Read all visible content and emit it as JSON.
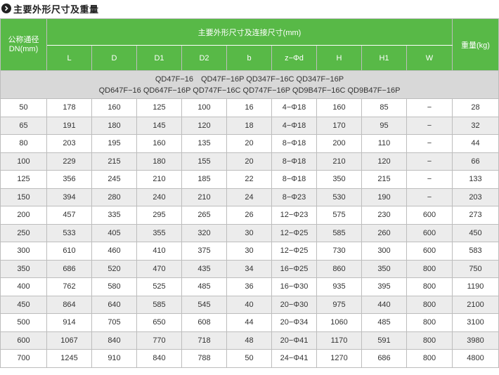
{
  "heading": {
    "title": "主要外形尺寸及重量",
    "icon": "chevron-right-icon"
  },
  "header": {
    "dn_label_line1": "公称通径",
    "dn_label_line2": "DN(mm)",
    "group_label": "主要外形尺寸及连接尺寸(mm)",
    "weight_label": "重量(kg)",
    "columns": [
      "L",
      "D",
      "D1",
      "D2",
      "b",
      "z−Φd",
      "H",
      "H1",
      "W"
    ]
  },
  "models": {
    "line1": "QD47F−16　QD47F−16P QD347F−16C QD347F−16P",
    "line2": "QD647F−16 QD647F−16P QD747F−16C QD747F−16P  QD9B47F−16C QD9B47F−16P"
  },
  "colors": {
    "header_bg": "#58b947",
    "models_bg": "#d8d8d8",
    "alt_row_bg": "#ececec"
  },
  "rows": [
    [
      "50",
      "178",
      "160",
      "125",
      "100",
      "16",
      "4−Φ18",
      "160",
      "85",
      "−",
      "28"
    ],
    [
      "65",
      "191",
      "180",
      "145",
      "120",
      "18",
      "4−Φ18",
      "170",
      "95",
      "−",
      "32"
    ],
    [
      "80",
      "203",
      "195",
      "160",
      "135",
      "20",
      "8−Φ18",
      "200",
      "110",
      "−",
      "44"
    ],
    [
      "100",
      "229",
      "215",
      "180",
      "155",
      "20",
      "8−Φ18",
      "210",
      "120",
      "−",
      "66"
    ],
    [
      "125",
      "356",
      "245",
      "210",
      "185",
      "22",
      "8−Φ18",
      "350",
      "215",
      "−",
      "133"
    ],
    [
      "150",
      "394",
      "280",
      "240",
      "210",
      "24",
      "8−Φ23",
      "530",
      "190",
      "−",
      "203"
    ],
    [
      "200",
      "457",
      "335",
      "295",
      "265",
      "26",
      "12−Φ23",
      "575",
      "230",
      "600",
      "273"
    ],
    [
      "250",
      "533",
      "405",
      "355",
      "320",
      "30",
      "12−Φ25",
      "585",
      "260",
      "600",
      "450"
    ],
    [
      "300",
      "610",
      "460",
      "410",
      "375",
      "30",
      "12−Φ25",
      "730",
      "300",
      "600",
      "583"
    ],
    [
      "350",
      "686",
      "520",
      "470",
      "435",
      "34",
      "16−Φ25",
      "860",
      "350",
      "800",
      "750"
    ],
    [
      "400",
      "762",
      "580",
      "525",
      "485",
      "36",
      "16−Φ30",
      "935",
      "395",
      "800",
      "1190"
    ],
    [
      "450",
      "864",
      "640",
      "585",
      "545",
      "40",
      "20−Φ30",
      "975",
      "440",
      "800",
      "2100"
    ],
    [
      "500",
      "914",
      "705",
      "650",
      "608",
      "44",
      "20−Φ34",
      "1060",
      "485",
      "800",
      "3100"
    ],
    [
      "600",
      "1067",
      "840",
      "770",
      "718",
      "48",
      "20−Φ41",
      "1170",
      "591",
      "800",
      "3980"
    ],
    [
      "700",
      "1245",
      "910",
      "840",
      "788",
      "50",
      "24−Φ41",
      "1270",
      "686",
      "800",
      "4800"
    ]
  ]
}
